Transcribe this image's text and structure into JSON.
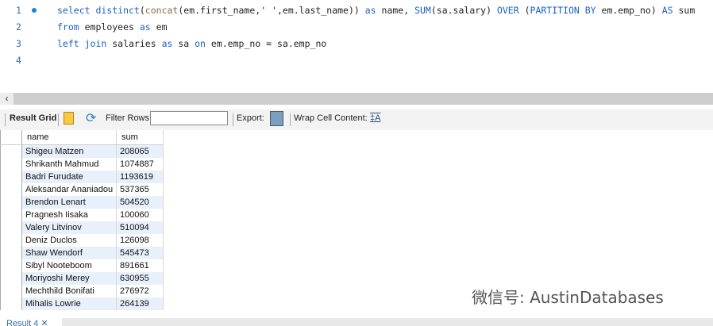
{
  "editor": {
    "lines": [
      {
        "num": "1",
        "tokens": [
          {
            "t": "select distinct",
            "k": "kw"
          },
          {
            "t": "(",
            "k": ""
          },
          {
            "t": "concat",
            "k": "fn"
          },
          {
            "t": "(em.first_name,' ',em.last_name)) ",
            "k": ""
          },
          {
            "t": "as",
            "k": "kw"
          },
          {
            "t": " name, ",
            "k": ""
          },
          {
            "t": "SUM",
            "k": "kw"
          },
          {
            "t": "(sa.salary) ",
            "k": ""
          },
          {
            "t": "OVER",
            "k": "kw"
          },
          {
            "t": " (",
            "k": ""
          },
          {
            "t": "PARTITION BY",
            "k": "kw"
          },
          {
            "t": " em.emp_no) ",
            "k": ""
          },
          {
            "t": "AS",
            "k": "kw"
          },
          {
            "t": " sum",
            "k": ""
          }
        ]
      },
      {
        "num": "2",
        "tokens": [
          {
            "t": "from",
            "k": "kw"
          },
          {
            "t": " employees ",
            "k": ""
          },
          {
            "t": "as",
            "k": "kw"
          },
          {
            "t": " em",
            "k": ""
          }
        ]
      },
      {
        "num": "3",
        "tokens": [
          {
            "t": "left join",
            "k": "kw"
          },
          {
            "t": " salaries ",
            "k": ""
          },
          {
            "t": "as",
            "k": "kw"
          },
          {
            "t": " sa ",
            "k": ""
          },
          {
            "t": "on",
            "k": "kw"
          },
          {
            "t": " em.emp_no = sa.emp_no",
            "k": ""
          }
        ]
      },
      {
        "num": "4",
        "tokens": []
      }
    ]
  },
  "toolbar": {
    "result_grid": "Result Grid",
    "filter_rows": "Filter Rows:",
    "filter_value": "",
    "export": "Export:",
    "wrap": "Wrap Cell Content:"
  },
  "grid": {
    "columns": [
      "name",
      "sum"
    ],
    "rows": [
      [
        "Shigeu Matzen",
        "208065"
      ],
      [
        "Shrikanth Mahmud",
        "1074887"
      ],
      [
        "Badri Furudate",
        "1193619"
      ],
      [
        "Aleksandar Ananiadou",
        "537365"
      ],
      [
        "Brendon Lenart",
        "504520"
      ],
      [
        "Pragnesh Iisaka",
        "100060"
      ],
      [
        "Valery Litvinov",
        "510094"
      ],
      [
        "Deniz Duclos",
        "126098"
      ],
      [
        "Shaw Wendorf",
        "545473"
      ],
      [
        "Sibyl Nooteboom",
        "891661"
      ],
      [
        "Moriyoshi Merey",
        "630955"
      ],
      [
        "Mechthild Bonifati",
        "276972"
      ],
      [
        "Mihalis Lowrie",
        "264139"
      ]
    ]
  },
  "result_tab": "Result 4",
  "watermark": "微信号: AustinDatabases"
}
